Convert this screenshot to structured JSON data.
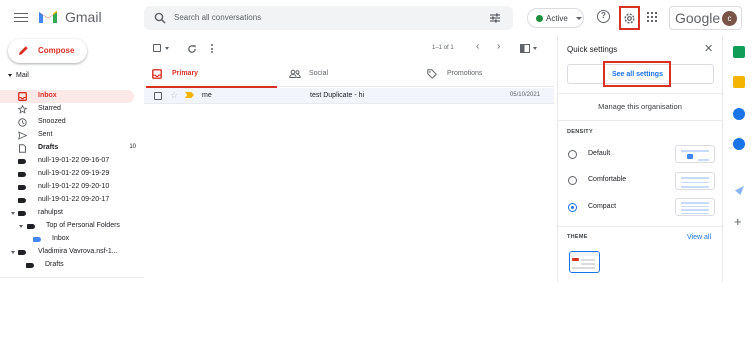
{
  "app": {
    "name": "Gmail",
    "google_word": "Google",
    "avatar_letter": "c"
  },
  "search": {
    "placeholder": "Search all conversations"
  },
  "status": {
    "label": "Active",
    "color": "#1e8e3e"
  },
  "icons": {
    "menu": "menu-icon",
    "search": "search-icon",
    "filter": "tune-icon",
    "help": "help-icon",
    "settings": "gear-icon",
    "apps": "apps-grid-icon"
  },
  "compose": {
    "label": "Compose"
  },
  "sidebar": {
    "section": "Mail",
    "items": [
      {
        "label": "Inbox",
        "icon": "inbox-icon",
        "active": true
      },
      {
        "label": "Starred",
        "icon": "star-icon"
      },
      {
        "label": "Snoozed",
        "icon": "clock-icon"
      },
      {
        "label": "Sent",
        "icon": "send-icon"
      },
      {
        "label": "Drafts",
        "icon": "file-icon",
        "count": "10"
      },
      {
        "label": "null-19-01-22 09-16-07",
        "icon": "label-icon"
      },
      {
        "label": "null-19-01-22 09-19-29",
        "icon": "label-icon"
      },
      {
        "label": "null-19-01-22 09-20-10",
        "icon": "label-icon"
      },
      {
        "label": "null-19-01-22 09-20-17",
        "icon": "label-icon"
      },
      {
        "label": "rahulpst",
        "icon": "label-icon"
      },
      {
        "label": "Top of Personal Folders",
        "icon": "label-icon"
      },
      {
        "label": "Inbox",
        "icon": "label-icon"
      },
      {
        "label": "Vladimira Vavrova.nsf-1...",
        "icon": "label-icon"
      },
      {
        "label": "Drafts",
        "icon": "label-icon"
      }
    ]
  },
  "toolbar": {
    "page_count": "1–1 of 1"
  },
  "tabs": [
    {
      "label": "Primary",
      "icon": "inbox-icon"
    },
    {
      "label": "Social",
      "icon": "people-icon"
    },
    {
      "label": "Promotions",
      "icon": "tag-icon"
    }
  ],
  "messages": [
    {
      "sender": "me",
      "subject": "test Duplicate - hi",
      "date": "05/10/2021"
    }
  ],
  "quick_settings": {
    "title": "Quick settings",
    "see_all": "See all settings",
    "manage": "Manage this organisation",
    "density_heading": "DENSITY",
    "density_options": [
      {
        "label": "Default",
        "selected": false
      },
      {
        "label": "Comfortable",
        "selected": false
      },
      {
        "label": "Compact",
        "selected": true
      }
    ],
    "theme_heading": "THEME",
    "view_all": "View all"
  },
  "colors": {
    "accent_red": "#d93025",
    "link_blue": "#1a73e8",
    "active_bg": "#fce8e6"
  }
}
